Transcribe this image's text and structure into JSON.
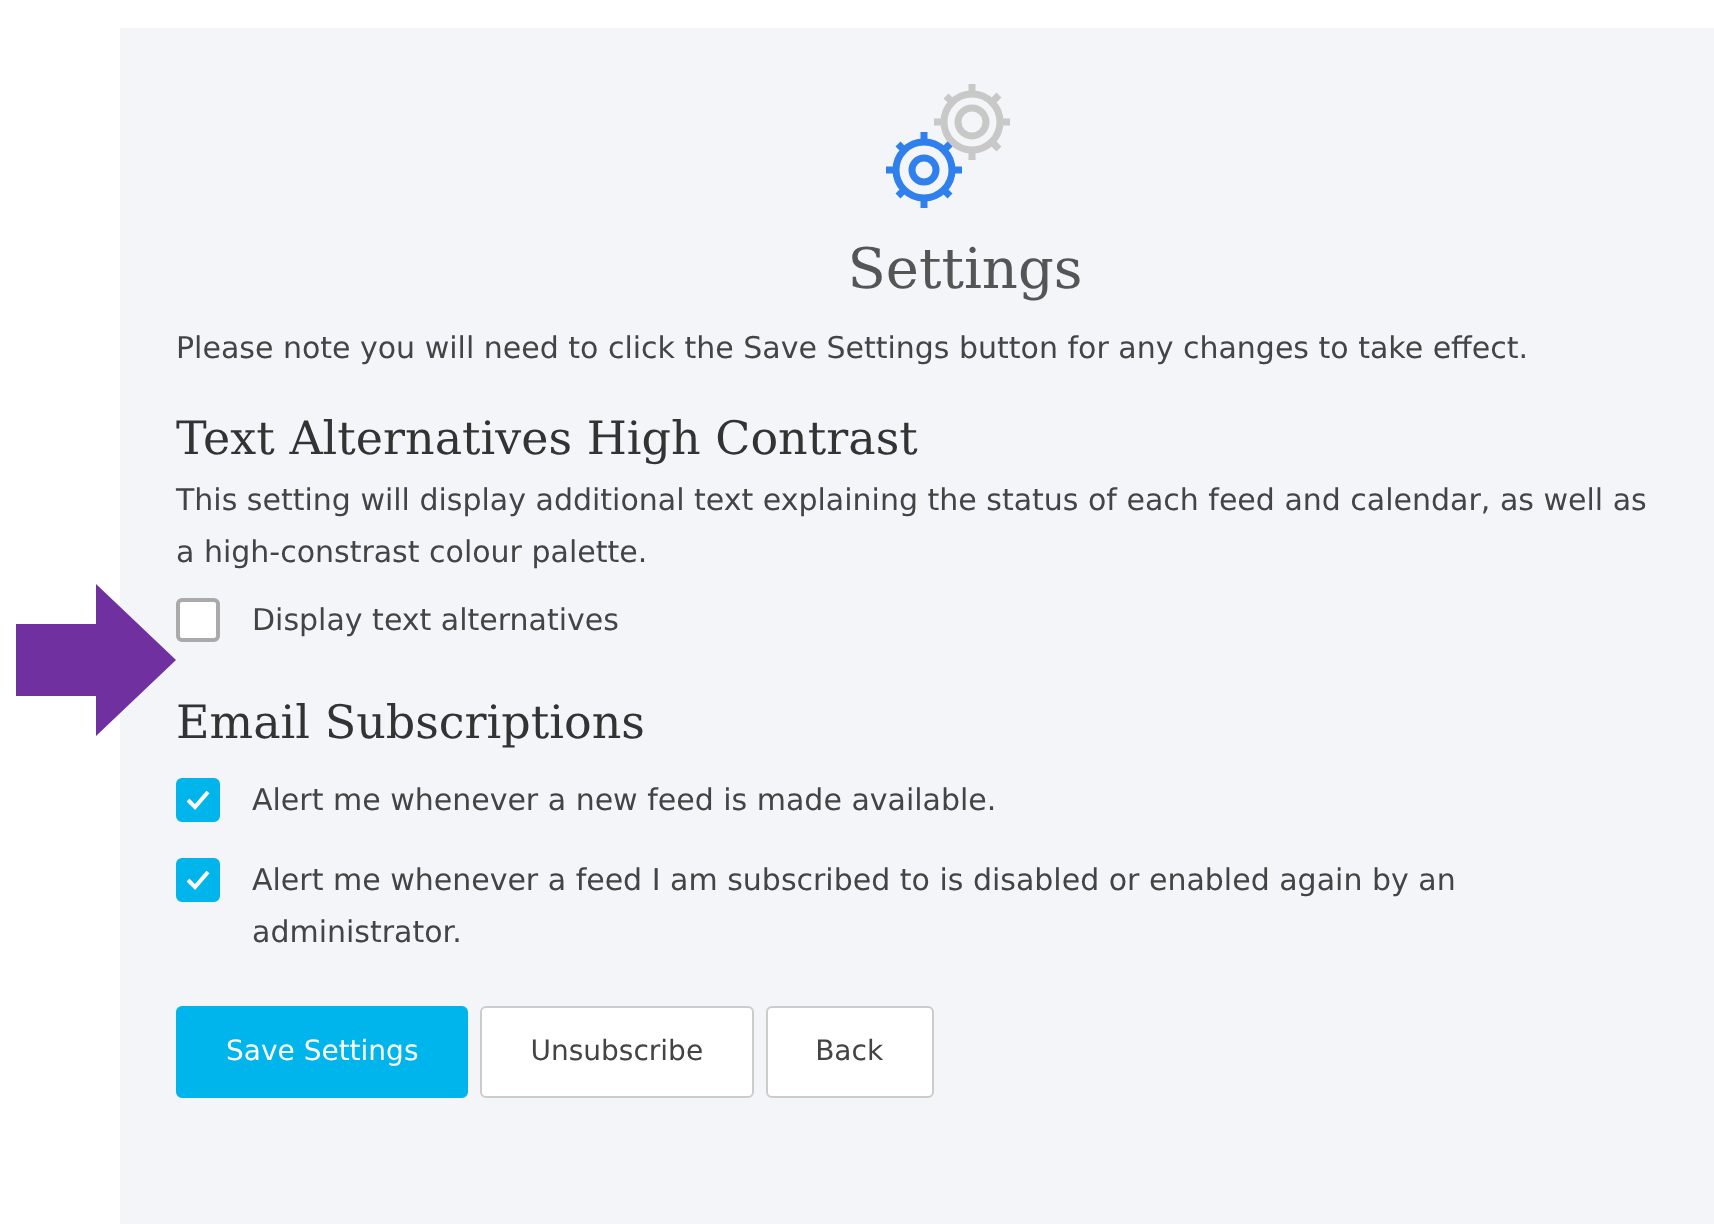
{
  "title": "Settings",
  "note": "Please note you will need to click the Save Settings button for any changes to take effect.",
  "sections": [
    {
      "heading": "Text Alternatives High Contrast",
      "description": "This setting will display additional text explaining the status of each feed and calendar, as well as a high-constrast colour palette.",
      "options": [
        {
          "label": "Display text alternatives",
          "checked": false
        }
      ]
    },
    {
      "heading": "Email Subscriptions",
      "options": [
        {
          "label": "Alert me whenever a new feed is made available.",
          "checked": true
        },
        {
          "label": "Alert me whenever a feed I am subscribed to is disabled or enabled again by an administrator.",
          "checked": true
        }
      ]
    }
  ],
  "buttons": [
    {
      "label": "Save Settings",
      "kind": "primary"
    },
    {
      "label": "Unsubscribe",
      "kind": "secondary"
    },
    {
      "label": "Back",
      "kind": "secondary"
    }
  ]
}
